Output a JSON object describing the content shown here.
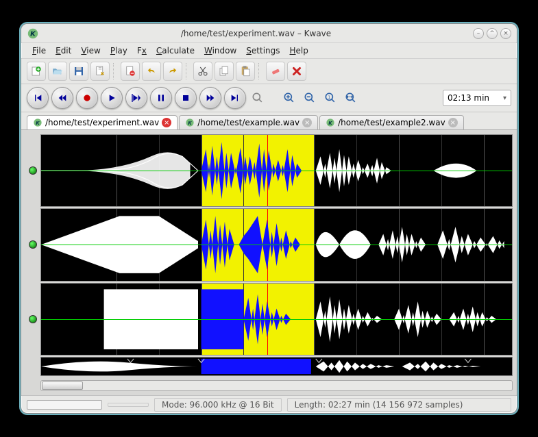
{
  "window": {
    "title": "/home/test/experiment.wav – Kwave",
    "min_icon": "–",
    "max_icon": "^",
    "close_icon": "×"
  },
  "menus": {
    "file": "File",
    "edit": "Edit",
    "view": "View",
    "play": "Play",
    "fx": "Fx",
    "calculate": "Calculate",
    "window": "Window",
    "settings": "Settings",
    "help": "Help"
  },
  "toolbar": {
    "new_tab": "new-tab",
    "open": "open",
    "save": "save",
    "save_as": "save-as",
    "close": "close",
    "undo": "undo",
    "redo": "redo",
    "cut": "cut",
    "copy": "copy",
    "paste": "paste",
    "erase": "erase",
    "delete": "delete"
  },
  "transport": {
    "start": "skip-start",
    "rewind": "rewind",
    "record": "record",
    "play": "play",
    "loop": "loop",
    "pause": "pause",
    "stop": "stop",
    "forward": "forward",
    "end": "skip-end"
  },
  "zoom": {
    "zoom_sel": "zoom-selection",
    "zoom_in": "zoom-in",
    "zoom_out": "zoom-out",
    "zoom_1_1": "zoom-1-1",
    "zoom_all": "zoom-all",
    "time_value": "02:13 min"
  },
  "tabs": [
    {
      "path": "/home/test/experiment.wav",
      "active": true
    },
    {
      "path": "/home/test/example.wav",
      "active": false
    },
    {
      "path": "/home/test/example2.wav",
      "active": false
    }
  ],
  "tracks": {
    "count": 3
  },
  "selection": {
    "start_pct": 34,
    "end_pct": 58
  },
  "cursor": {
    "pos_pct": 48
  },
  "statusbar": {
    "mode": "Mode: 96.000 kHz @ 16 Bit",
    "length": "Length: 02:27 min (14 156 972 samples)"
  }
}
